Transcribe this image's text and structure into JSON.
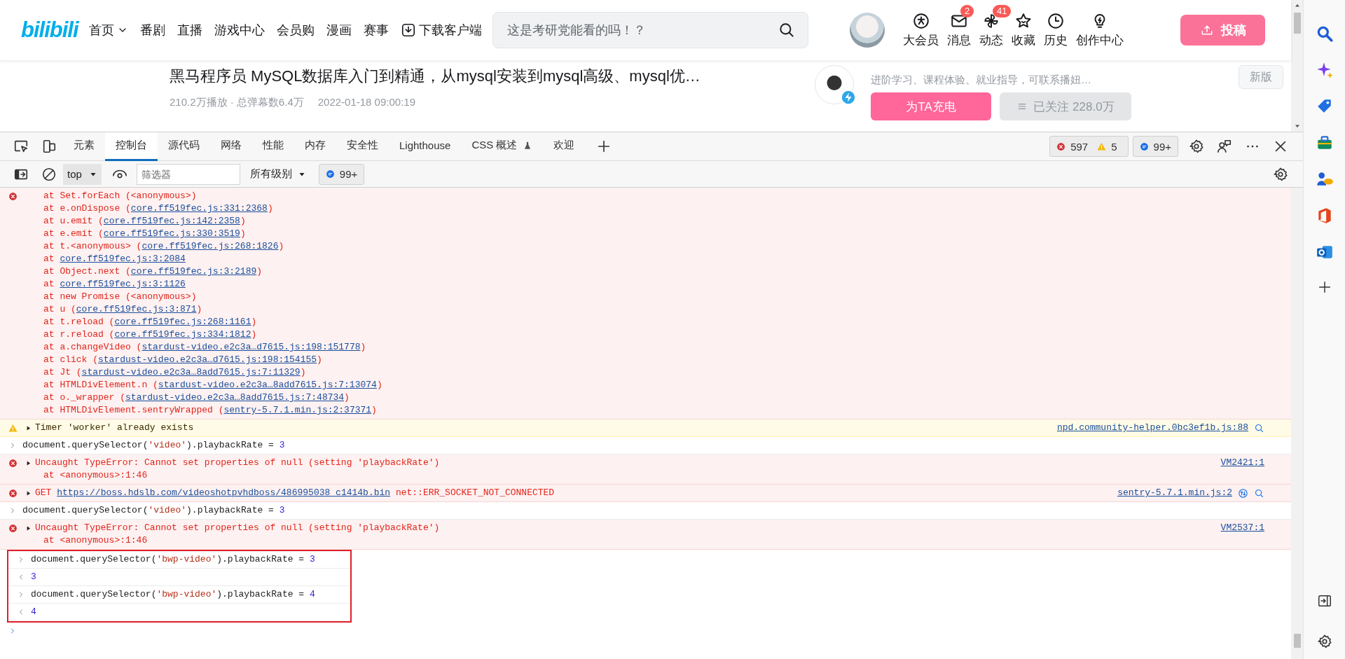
{
  "header": {
    "logo": "bilibili",
    "nav": [
      {
        "label": "首页",
        "kind": "dropdown"
      },
      {
        "label": "番剧",
        "kind": "plain"
      },
      {
        "label": "直播",
        "kind": "plain"
      },
      {
        "label": "游戏中心",
        "kind": "plain"
      },
      {
        "label": "会员购",
        "kind": "plain"
      },
      {
        "label": "漫画",
        "kind": "plain"
      },
      {
        "label": "赛事",
        "kind": "plain"
      },
      {
        "label": "下载客户端",
        "kind": "download"
      }
    ],
    "search": {
      "placeholder": "这是考研党能看的吗！？"
    },
    "user_menu": [
      {
        "label": "大会员"
      },
      {
        "label": "消息",
        "badge": "2"
      },
      {
        "label": "动态",
        "badge": "41"
      },
      {
        "label": "收藏"
      },
      {
        "label": "历史"
      },
      {
        "label": "创作中心"
      }
    ],
    "upload_button": "投稿"
  },
  "video": {
    "title": "黑马程序员 MySQL数据库入门到精通，从mysql安装到mysql高级、mysql优…",
    "stats": "210.2万播放 · 总弹幕数6.4万",
    "date": "2022-01-18 09:00:19"
  },
  "uploader": {
    "bio": "进阶学习、课程体验、就业指导，可联系播妞…",
    "charge_button": "为TA充电",
    "follow_button": "已关注 228.0万",
    "version_button": "新版"
  },
  "devtools": {
    "tabs": [
      {
        "label": "元素",
        "selected": false
      },
      {
        "label": "控制台",
        "selected": true
      },
      {
        "label": "源代码",
        "selected": false
      },
      {
        "label": "网络",
        "selected": false
      },
      {
        "label": "性能",
        "selected": false
      },
      {
        "label": "内存",
        "selected": false
      },
      {
        "label": "安全性",
        "selected": false
      },
      {
        "label": "Lighthouse",
        "selected": false
      },
      {
        "label": "CSS 概述",
        "selected": false,
        "beta": true
      },
      {
        "label": "欢迎",
        "selected": false
      }
    ],
    "error_count": "597",
    "warning_count": "5",
    "message_count": "99+",
    "toolbar": {
      "context": "top",
      "filter": {
        "placeholder": "筛选器"
      },
      "levels": "所有级别",
      "message_count": "99+"
    }
  },
  "console": [
    {
      "kind": "error",
      "lines": [
        {
          "text": "at Set.forEach (<anonymous>)"
        },
        {
          "text": "at e.onDispose (",
          "link": "core.ff519fec.js:331:2368",
          "after": ")"
        },
        {
          "text": "at u.emit (",
          "link": "core.ff519fec.js:142:2358",
          "after": ")"
        },
        {
          "text": "at e.emit (",
          "link": "core.ff519fec.js:330:3519",
          "after": ")"
        },
        {
          "text": "at t.<anonymous> (",
          "link": "core.ff519fec.js:268:1826",
          "after": ")"
        },
        {
          "text": "at ",
          "link": "core.ff519fec.js:3:2084"
        },
        {
          "text": "at Object.next (",
          "link": "core.ff519fec.js:3:2189",
          "after": ")"
        },
        {
          "text": "at ",
          "link": "core.ff519fec.js:3:1126"
        },
        {
          "text": "at new Promise (<anonymous>)"
        },
        {
          "text": "at u (",
          "link": "core.ff519fec.js:3:871",
          "after": ")"
        },
        {
          "text": "at t.reload (",
          "link": "core.ff519fec.js:268:1161",
          "after": ")"
        },
        {
          "text": "at r.reload (",
          "link": "core.ff519fec.js:334:1812",
          "after": ")"
        },
        {
          "text": "at a.changeVideo (",
          "link": "stardust-video.e2c3a…d7615.js:198:151778",
          "after": ")"
        },
        {
          "text": "at click (",
          "link": "stardust-video.e2c3a…d7615.js:198:154155",
          "after": ")"
        },
        {
          "text": "at Jt (",
          "link": "stardust-video.e2c3a…8add7615.js:7:11329",
          "after": ")"
        },
        {
          "text": "at HTMLDivElement.n (",
          "link": "stardust-video.e2c3a…8add7615.js:7:13074",
          "after": ")"
        },
        {
          "text": "at o._wrapper (",
          "link": "stardust-video.e2c3a…8add7615.js:7:48734",
          "after": ")"
        },
        {
          "text": "at HTMLDivElement.sentryWrapped (",
          "link": "sentry-5.7.1.min.js:2:37371",
          "after": ")"
        }
      ]
    },
    {
      "kind": "warning",
      "expandable": true,
      "message": {
        "text": "Timer 'worker' already exists"
      },
      "source": "npd.community-helper.0bc3ef1b.js:88",
      "search_icon": true
    },
    {
      "kind": "input",
      "code": [
        {
          "kind": "plain",
          "s": "document.querySelector("
        },
        {
          "kind": "string",
          "s": "'video'"
        },
        {
          "kind": "plain",
          "s": ").playbackRate = "
        },
        {
          "kind": "number",
          "s": "3"
        }
      ]
    },
    {
      "kind": "error",
      "expandable": true,
      "message": {
        "text": "Uncaught TypeError: Cannot set properties of null (setting 'playbackRate')"
      },
      "lines": [
        {
          "text": "at <anonymous>:1:46"
        }
      ],
      "source": "VM2421:1"
    },
    {
      "kind": "error",
      "expandable": true,
      "message": {
        "text": "GET ",
        "link": "https://boss.hdslb.com/videoshotpvhdboss/486995038_c1414b.bin",
        "after": " net::ERR_SOCKET_NOT_CONNECTED"
      },
      "source": "sentry-5.7.1.min.js:2",
      "network_icon": true,
      "search_icon": true
    },
    {
      "kind": "input",
      "code": [
        {
          "kind": "plain",
          "s": "document.querySelector("
        },
        {
          "kind": "string",
          "s": "'video'"
        },
        {
          "kind": "plain",
          "s": ").playbackRate = "
        },
        {
          "kind": "number",
          "s": "3"
        }
      ]
    },
    {
      "kind": "error",
      "expandable": true,
      "message": {
        "text": "Uncaught TypeError: Cannot set properties of null (setting 'playbackRate')"
      },
      "lines": [
        {
          "text": "at <anonymous>:1:46"
        }
      ],
      "source": "VM2537:1"
    },
    {
      "kind": "input",
      "annotated": true,
      "code": [
        {
          "kind": "plain",
          "s": "document.querySelector("
        },
        {
          "kind": "string",
          "s": "'bwp-video'"
        },
        {
          "kind": "plain",
          "s": ").playbackRate = "
        },
        {
          "kind": "number",
          "s": "3"
        }
      ]
    },
    {
      "kind": "output",
      "annotated": true,
      "code": [
        {
          "kind": "number",
          "s": "3"
        }
      ]
    },
    {
      "kind": "input",
      "annotated": true,
      "code": [
        {
          "kind": "plain",
          "s": "document.querySelector("
        },
        {
          "kind": "string",
          "s": "'bwp-video'"
        },
        {
          "kind": "plain",
          "s": ").playbackRate = "
        },
        {
          "kind": "number",
          "s": "4"
        }
      ]
    },
    {
      "kind": "output",
      "annotated": true,
      "code": [
        {
          "kind": "number",
          "s": "4"
        }
      ]
    },
    {
      "kind": "prompt"
    }
  ]
}
